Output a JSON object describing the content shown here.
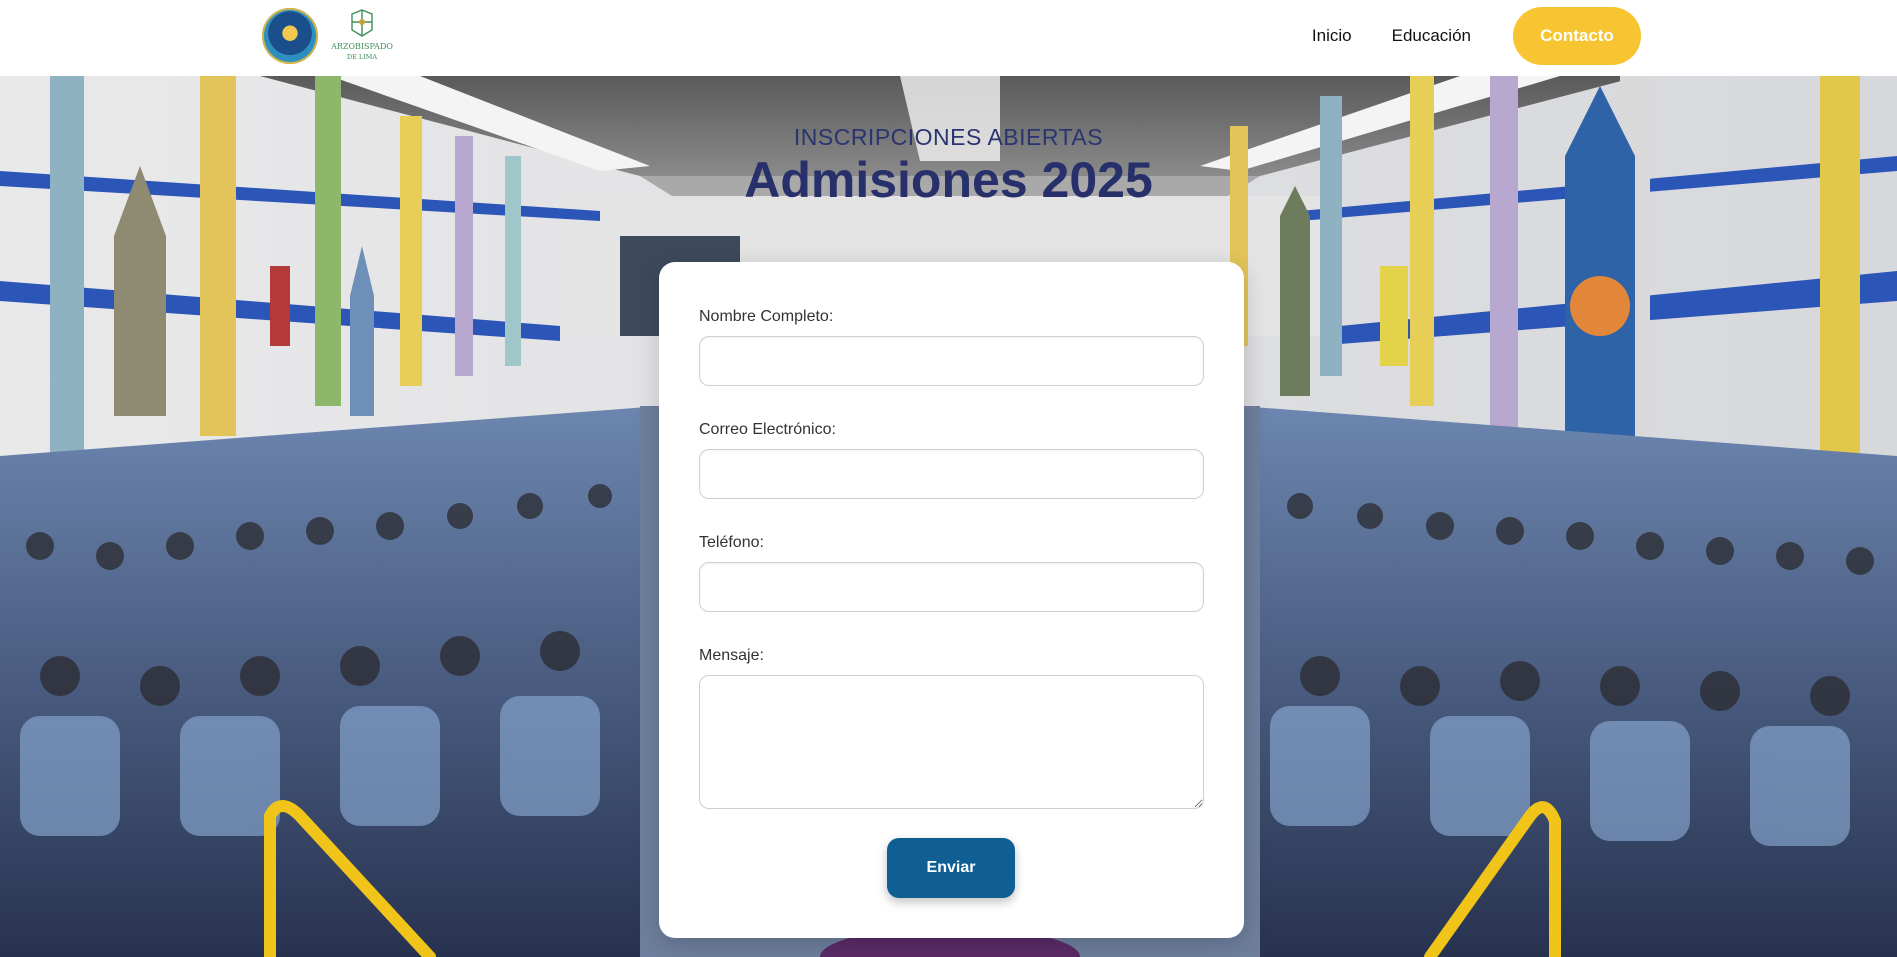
{
  "header": {
    "logo_school": "school-crest-icon",
    "logo_archdiocese_line1": "ARZOBISPADO",
    "logo_archdiocese_line2": "DE LIMA",
    "nav": [
      {
        "label": "Inicio"
      },
      {
        "label": "Educación"
      }
    ],
    "cta_label": "Contacto"
  },
  "hero": {
    "subtitle": "INSCRIPCIONES ABIERTAS",
    "title": "Admisiones 2025",
    "background": "students-assembly-photo"
  },
  "form": {
    "fields": [
      {
        "label": "Nombre Completo:",
        "value": "",
        "placeholder": ""
      },
      {
        "label": "Correo Electrónico:",
        "value": "",
        "placeholder": ""
      },
      {
        "label": "Teléfono:",
        "value": "",
        "placeholder": ""
      },
      {
        "label": "Mensaje:",
        "value": "",
        "placeholder": ""
      }
    ],
    "submit_label": "Enviar"
  },
  "colors": {
    "accent_yellow": "#f7c531",
    "primary_blue": "#0f5f94",
    "title_navy": "#27306a"
  }
}
